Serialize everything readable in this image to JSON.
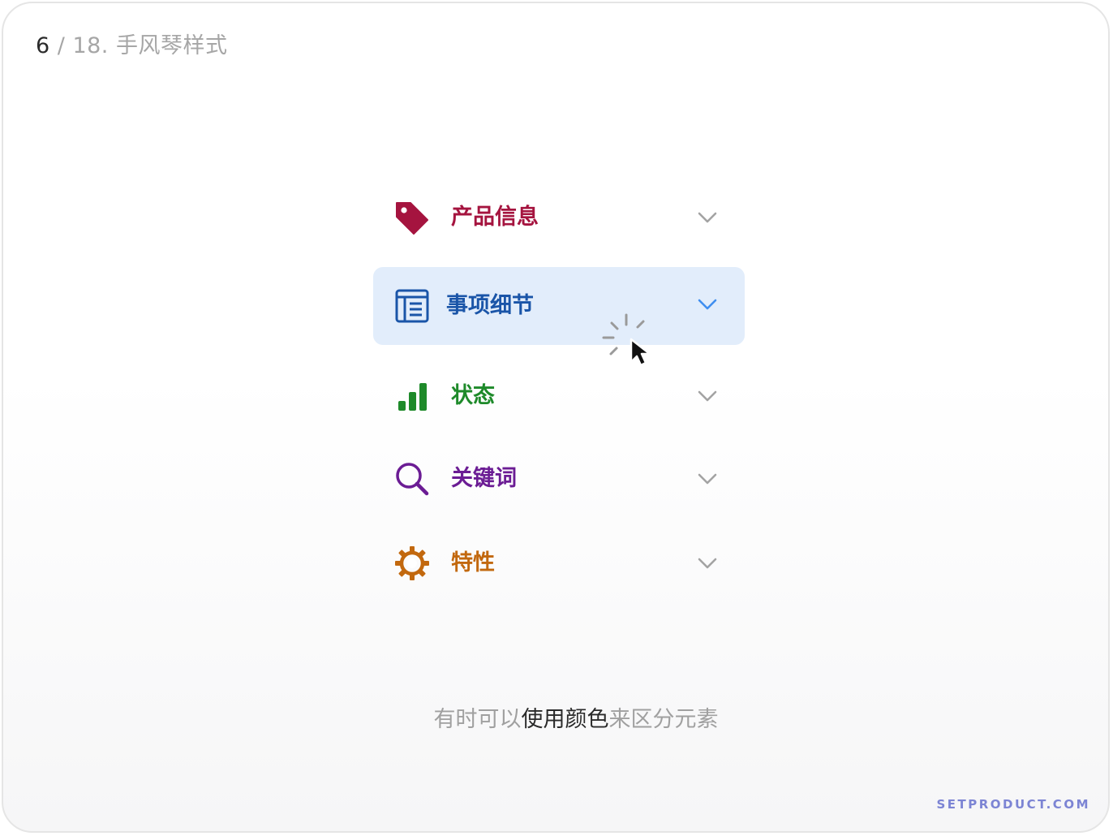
{
  "header": {
    "current": "6",
    "rest": " / 18. 手风琴样式"
  },
  "accordion": {
    "items": [
      {
        "label": "产品信息",
        "icon": "tag-icon",
        "color": "#a5143f",
        "active": false
      },
      {
        "label": "事项细节",
        "icon": "article-icon",
        "color": "#1a55a8",
        "active": true
      },
      {
        "label": "状态",
        "icon": "bar-chart-icon",
        "color": "#1e8a2a",
        "active": false
      },
      {
        "label": "关键词",
        "icon": "search-icon",
        "color": "#6b1c94",
        "active": false
      },
      {
        "label": "特性",
        "icon": "gear-icon",
        "color": "#c2680e",
        "active": false
      }
    ],
    "chevron_color": "#a3a3a3",
    "chevron_active_color": "#3f8ef0",
    "active_bg": "#e2edfb"
  },
  "caption": {
    "before": "有时可以",
    "highlight": "使用颜色",
    "after": "来区分元素"
  },
  "brand": "SETPRODUCT.COM"
}
